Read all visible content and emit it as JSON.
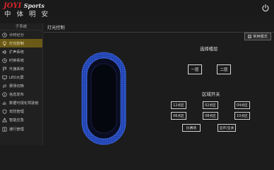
{
  "header": {
    "logo_brand": "JOYI",
    "logo_sports": "Sports",
    "logo_subtitle": "中 体 明 安",
    "power_icon": "power-icon"
  },
  "sidebar": {
    "title": "子系统",
    "items": [
      {
        "label": "计时记分",
        "icon": "clock-icon",
        "active": false
      },
      {
        "label": "灯光控制",
        "icon": "lightbulb-icon",
        "active": true
      },
      {
        "label": "扩声系统",
        "icon": "speaker-icon",
        "active": false
      },
      {
        "label": "时钟系统",
        "icon": "clock-icon",
        "active": false
      },
      {
        "label": "升旗系统",
        "icon": "flag-icon",
        "active": false
      },
      {
        "label": "LED大屏",
        "icon": "monitor-icon",
        "active": false
      },
      {
        "label": "赛场切换",
        "icon": "switch-icon",
        "active": false
      },
      {
        "label": "信息发布",
        "icon": "info-icon",
        "active": false
      },
      {
        "label": "数据可视化驾驶舱",
        "icon": "chart-icon",
        "active": false
      },
      {
        "label": "安防管理",
        "icon": "shield-icon",
        "active": false
      },
      {
        "label": "智能应急",
        "icon": "alert-icon",
        "active": false
      },
      {
        "label": "通行管理",
        "icon": "gate-icon",
        "active": false
      }
    ]
  },
  "main": {
    "title": "灯光控制",
    "mode_button": "常用模式",
    "floor_section": {
      "label": "选择楼层",
      "floors": [
        "一层",
        "二层"
      ]
    },
    "zone_section": {
      "label": "区域开关",
      "zones": [
        "12点区",
        "02点区",
        "04点区",
        "06点区",
        "08点区",
        "10点区"
      ],
      "actions": [
        "比赛场",
        "全开/全关"
      ]
    }
  },
  "colors": {
    "active_menu": "#6b5a17",
    "stadium_blue": "#1f3fa8",
    "field_dark": "#06081a"
  }
}
